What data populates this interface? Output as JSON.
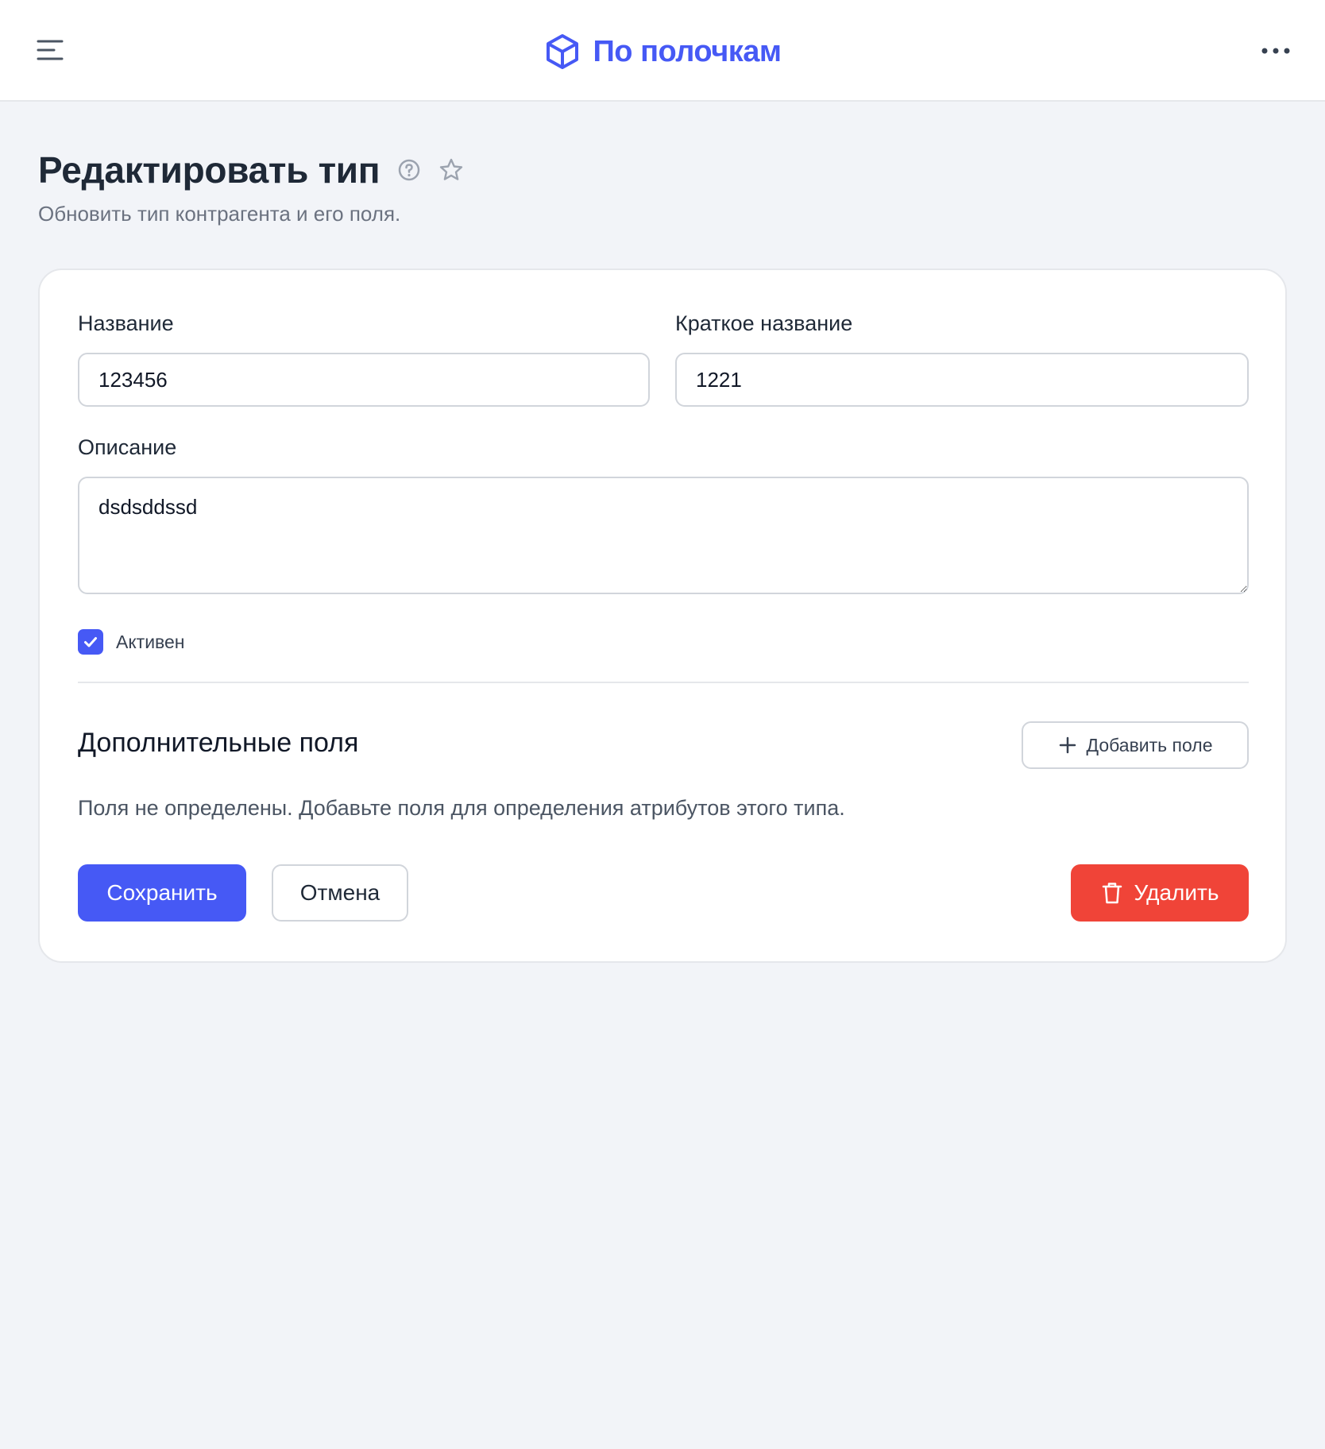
{
  "header": {
    "brand_name": "По полочкам",
    "brand_color": "#4659f5",
    "menu_icon": "menu-icon",
    "more_icon": "more-horizontal-icon",
    "logo_icon": "cube-icon"
  },
  "page": {
    "title": "Редактировать тип",
    "subtitle": "Обновить тип контрагента и его поля.",
    "help_icon": "help-circle-icon",
    "favorite_icon": "star-icon"
  },
  "form": {
    "name_label": "Название",
    "name_value": "123456",
    "short_name_label": "Краткое название",
    "short_name_value": "1221",
    "description_label": "Описание",
    "description_value": "dsdsddssd",
    "active_label": "Активен",
    "active_checked": true
  },
  "extra_fields": {
    "title": "Дополнительные поля",
    "add_button_label": "Добавить поле",
    "empty_message": "Поля не определены. Добавьте поля для определения атрибутов этого типа."
  },
  "actions": {
    "save_label": "Сохранить",
    "cancel_label": "Отмена",
    "delete_label": "Удалить",
    "save_color": "#4659f5",
    "delete_color": "#f04438"
  }
}
